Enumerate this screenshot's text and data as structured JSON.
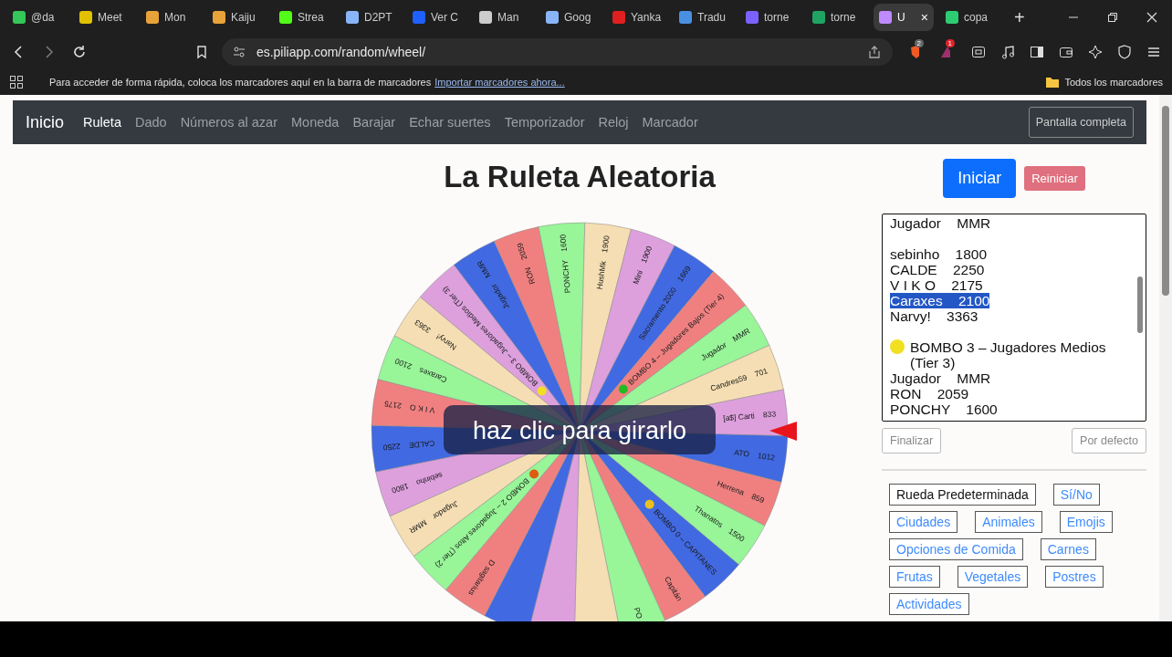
{
  "browser": {
    "tabs": [
      {
        "title": "@da",
        "color": "#34c759",
        "selected": false
      },
      {
        "title": "Meet",
        "color": "#e0c200",
        "selected": false
      },
      {
        "title": "Mon",
        "color": "#e8a23a",
        "selected": false
      },
      {
        "title": "Kaiju",
        "color": "#e8a23a",
        "selected": false
      },
      {
        "title": "Strea",
        "color": "#53fc18",
        "selected": false
      },
      {
        "title": "D2PT",
        "color": "#8ab4f8",
        "selected": false
      },
      {
        "title": "Ver C",
        "color": "#2060ff",
        "selected": false
      },
      {
        "title": "Man",
        "color": "#cccccc",
        "selected": false
      },
      {
        "title": "Goog",
        "color": "#8ab4f8",
        "selected": false
      },
      {
        "title": "Yanka",
        "color": "#e02020",
        "selected": false
      },
      {
        "title": "Tradu",
        "color": "#4a90e2",
        "selected": false
      },
      {
        "title": "torne",
        "color": "#7b61ff",
        "selected": false
      },
      {
        "title": "torne",
        "color": "#1fa463",
        "selected": false
      },
      {
        "title": "U",
        "color": "#c08aff",
        "selected": true
      },
      {
        "title": "copa",
        "color": "#2ecc71",
        "selected": false
      }
    ],
    "close_glyph": "×",
    "new_tab_glyph": "+",
    "url": "es.piliapp.com/random/wheel/",
    "badges": [
      "2",
      "1"
    ],
    "bookmarks_hint": "Para acceder de forma rápida, coloca los marcadores aquí en la barra de marcadores",
    "bookmarks_link": "Importar marcadores ahora...",
    "bookmarks_folder": "Todos los marcadores"
  },
  "nav": {
    "brand": "Inicio",
    "items": [
      {
        "label": "Ruleta",
        "selected": true
      },
      {
        "label": "Dado",
        "selected": false
      },
      {
        "label": "Números al azar",
        "selected": false
      },
      {
        "label": "Moneda",
        "selected": false
      },
      {
        "label": "Barajar",
        "selected": false
      },
      {
        "label": "Echar suertes",
        "selected": false
      },
      {
        "label": "Temporizador",
        "selected": false
      },
      {
        "label": "Reloj",
        "selected": false
      },
      {
        "label": "Marcador",
        "selected": false
      }
    ],
    "fullscreen": "Pantalla completa"
  },
  "title": "La Ruleta Aleatoria",
  "wheel": {
    "hint": "haz clic para girarlo",
    "segments": [
      {
        "kind": "entry",
        "label": "BOMBO 0 – CAPITANES",
        "marker": {
          "color": "#e8c020"
        }
      },
      {
        "kind": "entry",
        "label": "Capitán"
      },
      {
        "kind": "entry",
        "label": "PO"
      },
      {
        "kind": "blank"
      },
      {
        "kind": "blank"
      },
      {
        "kind": "blank"
      },
      {
        "kind": "entry",
        "label": "D sagitarius"
      },
      {
        "kind": "entry",
        "label": "BOMBO 2 – Jugadores Altos (Tier 2)",
        "marker": {
          "color": "#e05a10"
        }
      },
      {
        "kind": "entry",
        "label": "Jugador    MMR"
      },
      {
        "kind": "entry",
        "label": "sebinho    1800"
      },
      {
        "kind": "entry",
        "label": "CALDE    2250"
      },
      {
        "kind": "entry",
        "label": "V I K O    2175"
      },
      {
        "kind": "entry",
        "label": "Caraxes    2100"
      },
      {
        "kind": "entry",
        "label": "Narvy!    3363"
      },
      {
        "kind": "entry",
        "label": "BOMBO 3 – Jugadores Medios (Tier 3)",
        "marker": {
          "color": "#f0e020"
        }
      },
      {
        "kind": "entry",
        "label": "Jugador    MMR"
      },
      {
        "kind": "entry",
        "label": "RON    2059"
      },
      {
        "kind": "entry",
        "label": "PONCHY    1600"
      },
      {
        "kind": "entry",
        "label": "HushMk    1900"
      },
      {
        "kind": "entry",
        "label": "Mini    1900"
      },
      {
        "kind": "entry",
        "label": "Sacramento 2000    1669"
      },
      {
        "kind": "entry",
        "label": "BOMBO 4 – Jugadores Bajos (Tier 4)",
        "marker": {
          "color": "#22bb22"
        }
      },
      {
        "kind": "entry",
        "label": "Jugador    MMR"
      },
      {
        "kind": "entry",
        "label": "Candres59    701"
      },
      {
        "kind": "entry",
        "label": "[a$] Carti    833"
      },
      {
        "kind": "entry",
        "label": "ATO    1012"
      },
      {
        "kind": "entry",
        "label": "Herrena    859"
      },
      {
        "kind": "entry",
        "label": "Thanatos    1500"
      }
    ]
  },
  "controls": {
    "start": "Iniciar",
    "reset": "Reiniciar",
    "finish": "Finalizar",
    "default": "Por defecto"
  },
  "options": [
    {
      "text": "Jugador    MMR",
      "selected": false
    },
    {
      "text": "sebinho    1800",
      "selected": false,
      "gap_before": true
    },
    {
      "text": "CALDE    2250",
      "selected": false
    },
    {
      "text": "V I K O    2175",
      "selected": false
    },
    {
      "text": "Caraxes    2100",
      "selected": true
    },
    {
      "text": "Narvy!    3363",
      "selected": false
    },
    {
      "text": "BOMBO 3 – Jugadores Medios (Tier 3)",
      "selected": false,
      "marker": {
        "color": "#f0e020"
      },
      "gap_before": true
    },
    {
      "text": "Jugador    MMR",
      "selected": false
    },
    {
      "text": "RON    2059",
      "selected": false
    },
    {
      "text": "PONCHY    1600",
      "selected": false
    }
  ],
  "presets": [
    {
      "label": "Rueda Predeterminada",
      "selected": true
    },
    {
      "label": "Sí/No",
      "selected": false
    },
    {
      "label": "Ciudades",
      "selected": false
    },
    {
      "label": "Animales",
      "selected": false
    },
    {
      "label": "Emojis",
      "selected": false
    },
    {
      "label": "Opciones de Comida",
      "selected": false
    },
    {
      "label": "Carnes",
      "selected": false
    },
    {
      "label": "Frutas",
      "selected": false
    },
    {
      "label": "Vegetales",
      "selected": false
    },
    {
      "label": "Postres",
      "selected": false
    },
    {
      "label": "Actividades",
      "selected": false
    }
  ]
}
